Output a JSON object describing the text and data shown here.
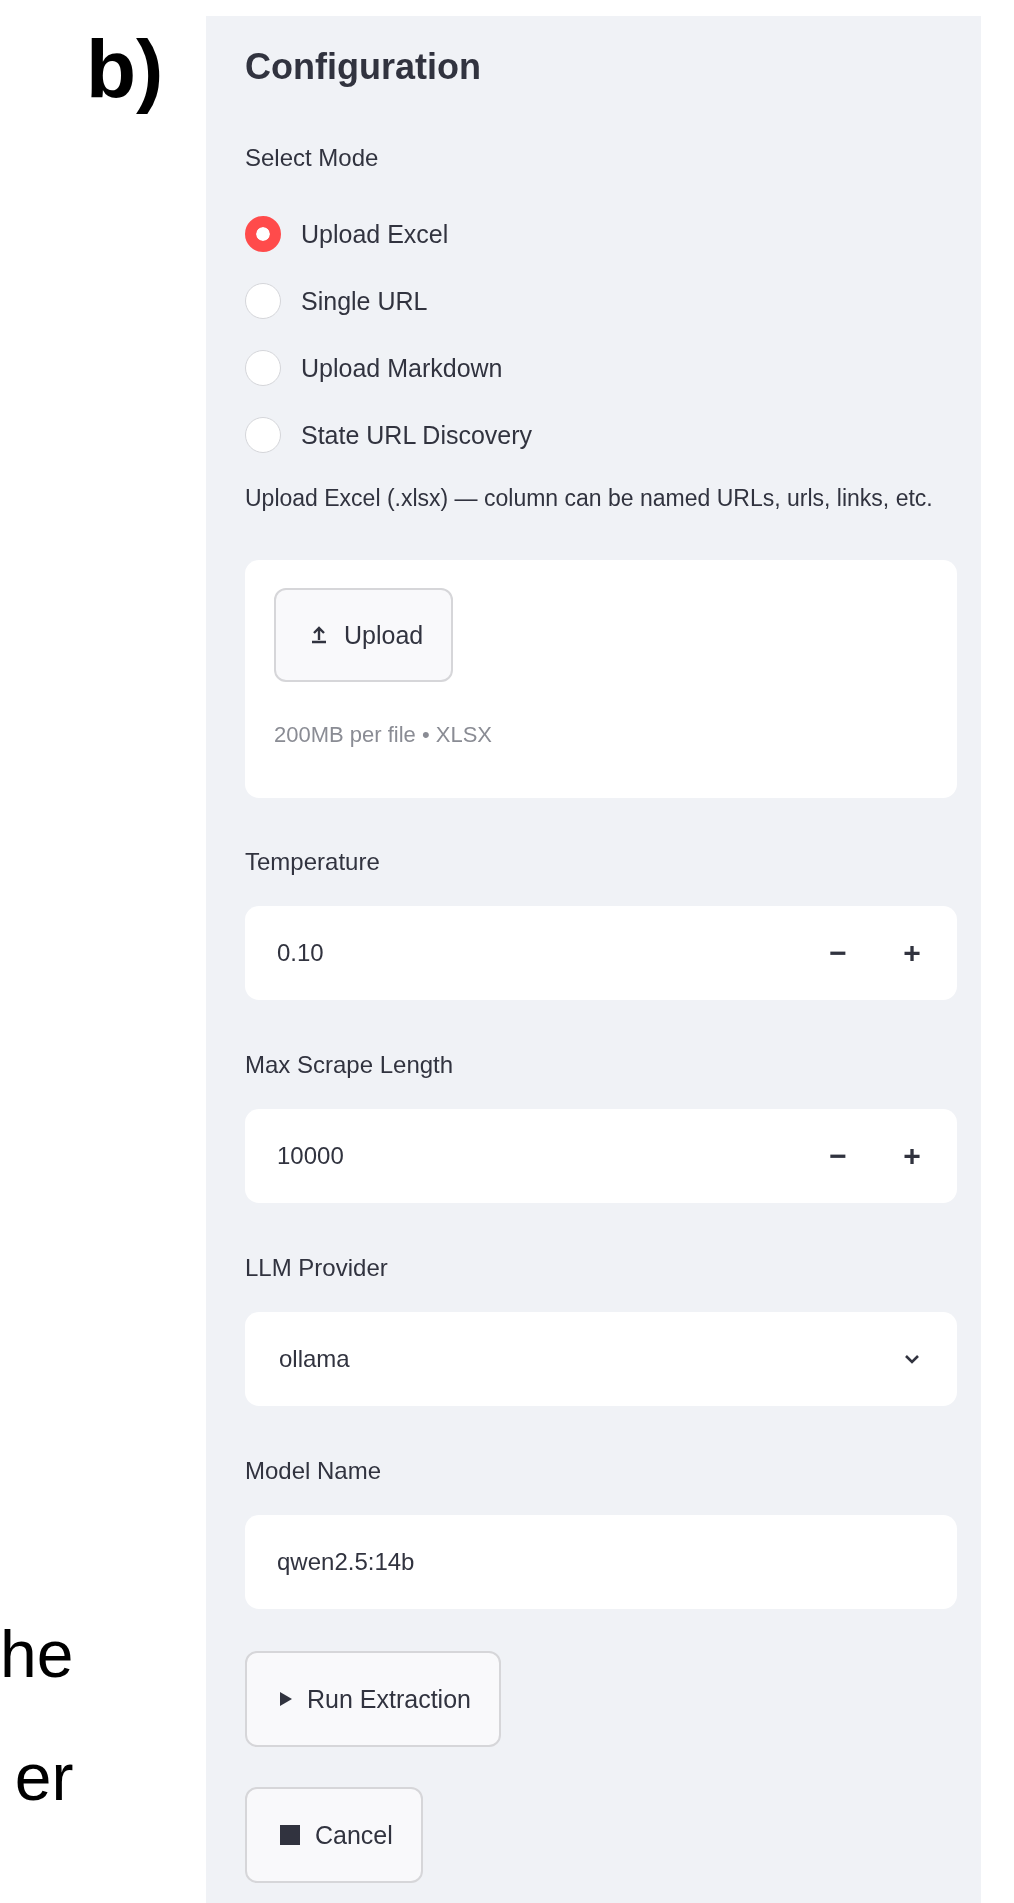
{
  "figure_label": "b)",
  "side_text": [
    "he",
    "er"
  ],
  "sidebar": {
    "title": "Configuration",
    "mode": {
      "label": "Select Mode",
      "options": [
        {
          "label": "Upload Excel",
          "selected": true
        },
        {
          "label": "Single URL",
          "selected": false
        },
        {
          "label": "Upload Markdown",
          "selected": false
        },
        {
          "label": "State URL Discovery",
          "selected": false
        }
      ]
    },
    "upload": {
      "label": "Upload Excel (.xlsx) — column can be named URLs, urls, links, etc.",
      "button": "Upload",
      "hint": "200MB per file • XLSX"
    },
    "fields": [
      {
        "kind": "number",
        "label": "Temperature",
        "value": "0.10",
        "minus": "−",
        "plus": "+"
      },
      {
        "kind": "number",
        "label": "Max Scrape Length",
        "value": "10000",
        "minus": "−",
        "plus": "+"
      },
      {
        "kind": "select",
        "label": "LLM Provider",
        "value": "ollama"
      },
      {
        "kind": "text",
        "label": "Model Name",
        "value": "qwen2.5:14b"
      }
    ],
    "buttons": [
      {
        "kind": "run",
        "label": "Run Extraction"
      },
      {
        "kind": "stop",
        "label": "Cancel"
      }
    ]
  }
}
